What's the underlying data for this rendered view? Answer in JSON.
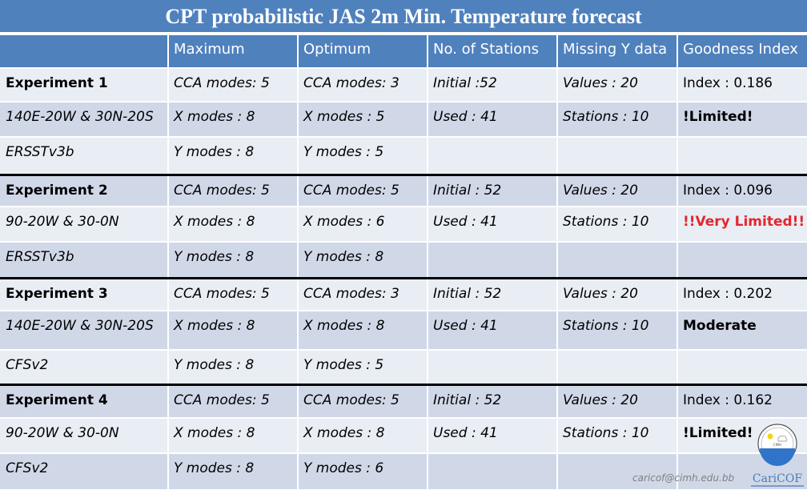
{
  "title": "CPT probabilistic JAS 2m Min. Temperature forecast",
  "headers": [
    "",
    "Maximum",
    "Optimum",
    "No. of Stations",
    "Missing Y data",
    "Goodness Index"
  ],
  "experiments": [
    {
      "rows": [
        [
          "Experiment 1",
          "CCA modes: 5",
          "CCA modes: 3",
          "Initial :52",
          "Values : 20",
          "Index : 0.186"
        ],
        [
          "140E-20W & 30N-20S",
          "X modes : 8",
          "X modes : 5",
          "Used : 41",
          "Stations : 10",
          "!Limited!"
        ],
        [
          "ERSSTv3b",
          "Y modes : 8",
          "Y modes : 5",
          "",
          "",
          ""
        ]
      ],
      "rating_style": "bold"
    },
    {
      "rows": [
        [
          "Experiment 2",
          "CCA modes: 5",
          "CCA modes: 5",
          "Initial : 52",
          "Values : 20",
          "Index : 0.096"
        ],
        [
          "90-20W & 30-0N",
          "X modes : 8",
          "X modes : 6",
          "Used : 41",
          "Stations : 10",
          "!!Very Limited!!"
        ],
        [
          "ERSSTv3b",
          "Y modes : 8",
          "Y modes : 8",
          "",
          "",
          ""
        ]
      ],
      "rating_style": "red"
    },
    {
      "rows": [
        [
          "Experiment 3",
          "CCA modes: 5",
          "CCA modes: 3",
          "Initial : 52",
          "Values : 20",
          "Index : 0.202"
        ],
        [
          "140E-20W & 30N-20S",
          "X modes : 8",
          "X modes : 8",
          "Used : 41",
          "Stations : 10",
          "Moderate"
        ],
        [
          "CFSv2",
          "Y modes : 8",
          "Y modes : 5",
          "",
          "",
          ""
        ]
      ],
      "rating_style": "bold"
    },
    {
      "rows": [
        [
          "Experiment 4",
          "CCA modes: 5",
          "CCA modes: 5",
          "Initial : 52",
          "Values : 20",
          "Index : 0.162"
        ],
        [
          "90-20W & 30-0N",
          "X modes : 8",
          "X modes : 8",
          "Used : 41",
          "Stations : 10",
          "!Limited!"
        ],
        [
          "CFSv2",
          "Y modes : 8",
          "Y modes : 6",
          "",
          "",
          ""
        ]
      ],
      "rating_style": "bold"
    }
  ],
  "footer": {
    "email": "caricof@cimh.edu.bb",
    "logo_label": "CariCOF",
    "logo_badge": "CIMH"
  },
  "colors": {
    "header_blue": "#4f81bd",
    "row_light": "#e9edf4",
    "row_dark": "#d0d8e8",
    "alert_red": "#e3262e"
  }
}
